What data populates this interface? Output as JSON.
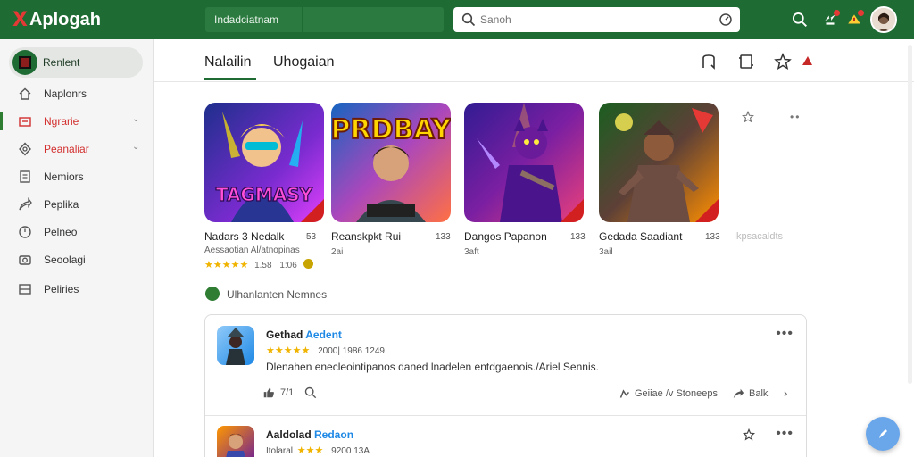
{
  "app": {
    "logo_mark": "X",
    "logo_text": "Aplogah"
  },
  "topbar": {
    "tab_label": "Indadciatnam",
    "search_placeholder": "Sanoh",
    "icons": [
      "search-icon",
      "notification-icon",
      "alert-icon",
      "avatar"
    ]
  },
  "sidebar": {
    "active_label": "Renlent",
    "items": [
      {
        "label": "Naplonrs",
        "icon": "home-icon"
      },
      {
        "label": "Ngrarie",
        "icon": "box-icon",
        "red": true,
        "chevron": "⌄"
      },
      {
        "label": "Peanaliar",
        "icon": "gear-icon",
        "red": true,
        "chevron": "⌄"
      },
      {
        "label": "Nemiors",
        "icon": "document-icon"
      },
      {
        "label": "Peplika",
        "icon": "share-icon"
      },
      {
        "label": "Pelneo",
        "icon": "clock-icon"
      },
      {
        "label": "Seoolagi",
        "icon": "camera-icon"
      },
      {
        "label": "Peliries",
        "icon": "list-icon"
      }
    ]
  },
  "main": {
    "tabs": [
      "Nalailin",
      "Uhogaian"
    ],
    "games": [
      {
        "name": "Nadars 3 Nedalk",
        "count": "53",
        "sub": "Aessaotian Al/atnopinas",
        "stars": "★★★★★",
        "rating": "1.58",
        "extra": "1:06",
        "art": "TAGMASY",
        "colors": [
          "#1e2f8c",
          "#7a2bd0",
          "#e040fb"
        ]
      },
      {
        "name": "Reanskpkt Rui",
        "count": "133",
        "sub": "2ai",
        "art": "PRDBAY",
        "colors": [
          "#1565c0",
          "#ffb300",
          "#ff7043"
        ]
      },
      {
        "name": "Dangos Papanon",
        "count": "133",
        "sub": "3aft",
        "colors": [
          "#311b92",
          "#7b1fa2",
          "#ec407a"
        ]
      },
      {
        "name": "Gedada Saadiant",
        "count": "133",
        "sub": "3ail",
        "colors": [
          "#1b5e20",
          "#5d4037",
          "#ff8f00"
        ]
      }
    ],
    "overflow_label": "Ikpsacaldts",
    "section_title": "Ulhanlanten Nemnes",
    "reviews": [
      {
        "title_a": "Gethad",
        "title_b": "Aedent",
        "stars": "★★★★★",
        "meta": "2000| 1986 1249",
        "body": "Dlenahen enecleointipanos daned lnadelen entdgaenois./Ariel Sennis.",
        "likes": "7/1",
        "share_label": "Geiiae /v Stoneeps",
        "reply_label": "Balk"
      },
      {
        "title_a": "Aaldolad",
        "title_b": "Redaon",
        "stars": "★★★",
        "prefix": "Itolaral",
        "meta": "9200 13A"
      }
    ]
  },
  "colors": {
    "brand": "#1f6b34",
    "accent": "#1e88e5",
    "star": "#f0b400",
    "alert": "#d32f2f"
  }
}
